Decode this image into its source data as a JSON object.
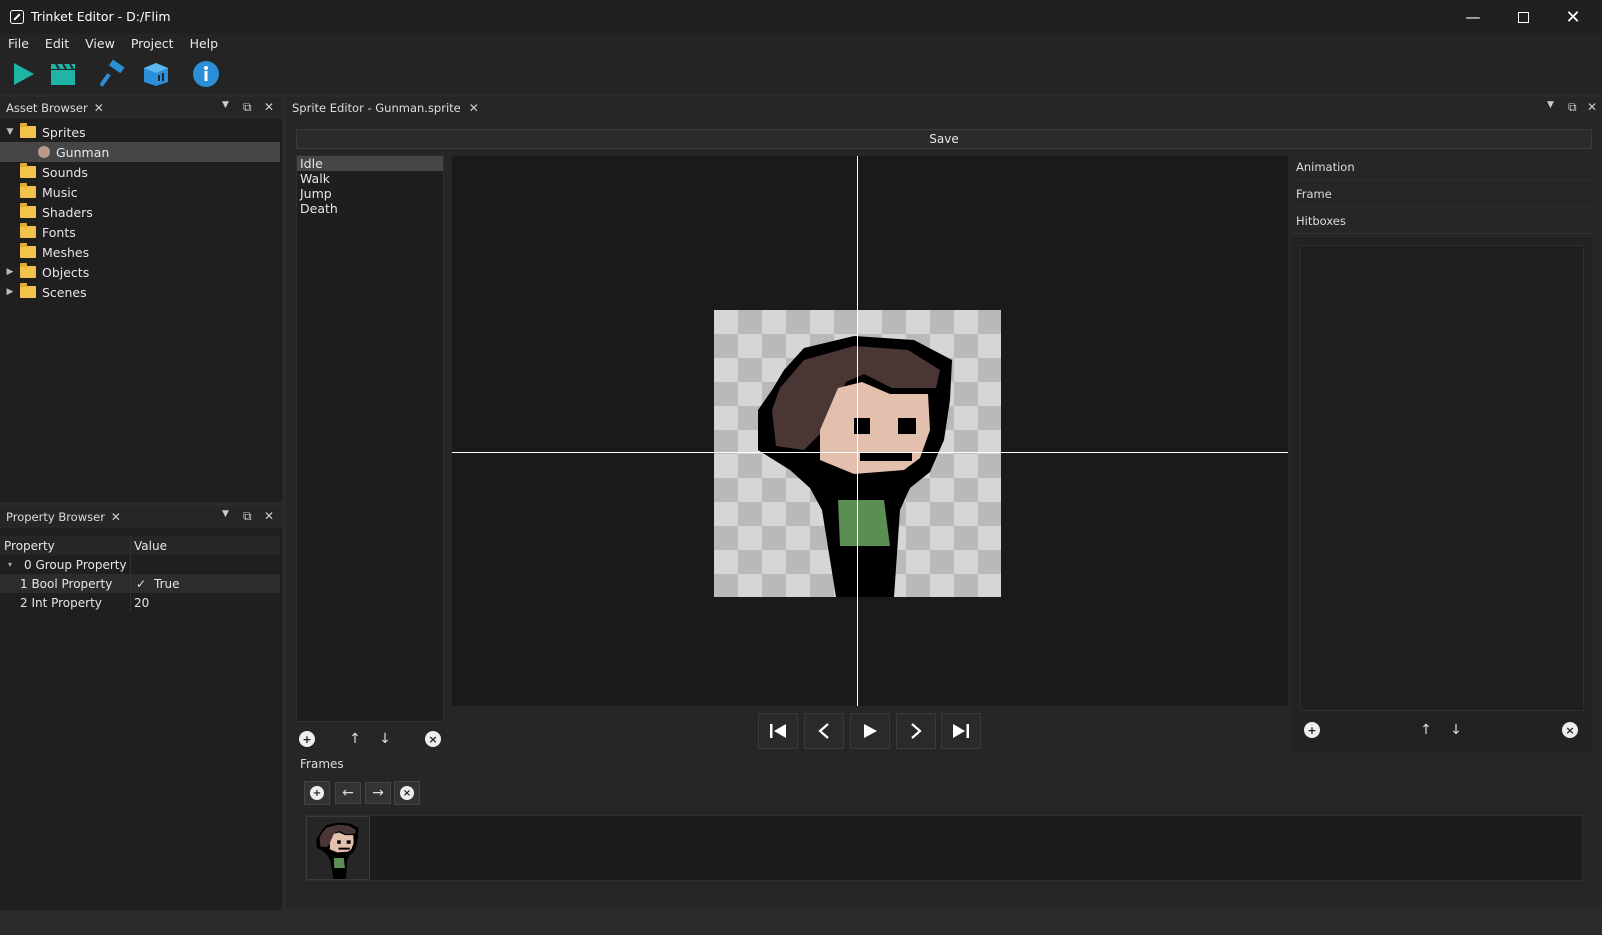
{
  "window": {
    "title": "Trinket Editor - D:/Flim"
  },
  "menu": [
    "File",
    "Edit",
    "View",
    "Project",
    "Help"
  ],
  "toolbar": [
    {
      "icon": "play-icon",
      "color": "#1fb5a6"
    },
    {
      "icon": "clapperboard-icon",
      "color": "#1fb5a6"
    },
    {
      "icon": "hammer-icon",
      "color": "#2a8fd6"
    },
    {
      "icon": "package-icon",
      "color": "#2a8fd6"
    },
    {
      "icon": "info-icon",
      "color": "#2a8fd6"
    }
  ],
  "asset_browser": {
    "title": "Asset Browser",
    "items": [
      {
        "label": "Sprites",
        "expanded": true
      },
      {
        "label": "Gunman",
        "selected": true
      },
      {
        "label": "Sounds"
      },
      {
        "label": "Music"
      },
      {
        "label": "Shaders"
      },
      {
        "label": "Fonts"
      },
      {
        "label": "Meshes"
      },
      {
        "label": "Objects",
        "collapsed": true
      },
      {
        "label": "Scenes",
        "collapsed": true
      }
    ]
  },
  "property_browser": {
    "title": "Property Browser",
    "headers": [
      "Property",
      "Value"
    ],
    "rows": [
      {
        "name": "0 Group Property",
        "value": ""
      },
      {
        "name": "1 Bool Property",
        "value": "True",
        "check": "✓"
      },
      {
        "name": "2 Int Property",
        "value": "20"
      }
    ]
  },
  "sprite_editor": {
    "tab": "Sprite Editor - Gunman.sprite",
    "save_label": "Save",
    "animations": [
      "Idle",
      "Walk",
      "Jump",
      "Death"
    ],
    "selected_animation": "Idle",
    "right_sections": [
      "Animation",
      "Frame",
      "Hitboxes"
    ],
    "frames_label": "Frames"
  }
}
